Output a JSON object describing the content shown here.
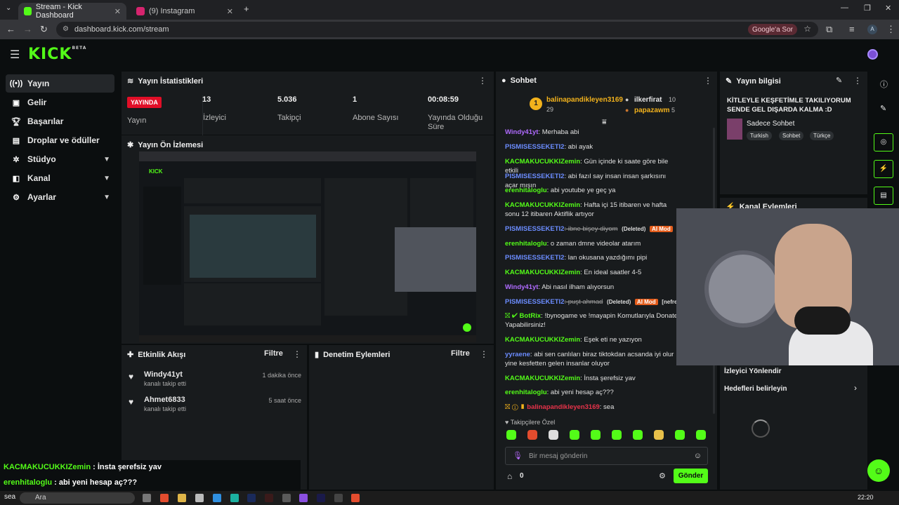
{
  "browser": {
    "tabs": [
      {
        "title": "Stream - Kick Dashboard",
        "active": true,
        "favicon_color": "#53fc18"
      },
      {
        "title": "(9) Instagram",
        "active": false,
        "favicon_color": "#d6246e"
      }
    ],
    "url": "dashboard.kick.com/stream",
    "ask_google_label": "Google'a Sor"
  },
  "brand": {
    "logo": "KICK",
    "logo_tag": "BETA",
    "accent": "#53fc18"
  },
  "sidebar": {
    "items": [
      {
        "label": "Yayın",
        "icon": "broadcast-icon",
        "active": true,
        "expandable": false
      },
      {
        "label": "Gelir",
        "icon": "revenue-icon",
        "active": false,
        "expandable": false
      },
      {
        "label": "Başarılar",
        "icon": "trophy-icon",
        "active": false,
        "expandable": false
      },
      {
        "label": "Droplar ve ödüller",
        "icon": "gift-icon",
        "active": false,
        "expandable": false
      },
      {
        "label": "Stüdyo",
        "icon": "studio-icon",
        "active": false,
        "expandable": true
      },
      {
        "label": "Kanal",
        "icon": "channel-icon",
        "active": false,
        "expandable": true
      },
      {
        "label": "Ayarlar",
        "icon": "gear-icon",
        "active": false,
        "expandable": true
      }
    ]
  },
  "stats": {
    "title": "Yayın İstatistikleri",
    "live_badge": "YAYINDA",
    "live_label": "Yayın",
    "viewers": "13",
    "viewers_label": "İzleyici",
    "followers": "5.036",
    "followers_label": "Takipçi",
    "subs": "1",
    "subs_label": "Abone Sayısı",
    "uptime": "00:08:59",
    "uptime_label": "Yayında Olduğu Süre"
  },
  "preview": {
    "title": "Yayın Ön İzlemesi"
  },
  "events": {
    "title": "Etkinlik Akışı",
    "filter": "Filtre",
    "items": [
      {
        "user": "Windy41yt",
        "action": "kanalı takip etti",
        "time": "1 dakika önce"
      },
      {
        "user": "Ahmet6833",
        "action": "kanalı takip etti",
        "time": "5 saat önce"
      }
    ]
  },
  "moderation": {
    "title": "Denetim Eylemleri",
    "filter": "Filtre"
  },
  "chat": {
    "title": "Sohbet",
    "top_gifters": [
      {
        "rank": "1",
        "name": "balinapandikleyen3169",
        "count": "29"
      },
      {
        "name": "ilkerfirat",
        "count": "10"
      },
      {
        "name": "papazawm",
        "count": "5"
      }
    ],
    "messages": [
      {
        "user": "Windy41yt",
        "color": "#b06bff",
        "text": ": Merhaba abi"
      },
      {
        "user": "PISMISESSEKETI2",
        "color": "#6b8cff",
        "text": ": abi ayak"
      },
      {
        "user": "KACMAKUCUKKIZemin",
        "color": "#53fc18",
        "text": ": Gün içinde ki saate göre bile etkili"
      },
      {
        "user": "PISMISESSEKETI2",
        "color": "#6b8cff",
        "text": ": abi fazıl say insan insan şarkısını açar mışın"
      },
      {
        "user": "erenhitaloglu",
        "color": "#53fc18",
        "text": ": abi youtube ye geç ya"
      },
      {
        "user": "KACMAKUCUKKIZemin",
        "color": "#53fc18",
        "text": ": Hafta içi 15 itibaren ve hafta sonu 12 itibaren Aktiflik artıyor"
      },
      {
        "user": "PISMISESSEKETI2",
        "color": "#6b8cff",
        "text": ": ibne bişey diyom",
        "deleted": "(Deleted)",
        "mod": "AI Mod",
        "note": "[nefret"
      },
      {
        "user": "erenhitaloglu",
        "color": "#53fc18",
        "text": ": o zaman dmne videolar atarım"
      },
      {
        "user": "PISMISESSEKETI2",
        "color": "#6b8cff",
        "text": ": lan okusana yazdığımı pipi"
      },
      {
        "user": "KACMAKUCUKKIZemin",
        "color": "#53fc18",
        "text": ": En ideal saatler 4-5"
      },
      {
        "user": "Windy41yt",
        "color": "#b06bff",
        "text": ": Abi nasıl ilham alıyorsun"
      },
      {
        "user": "PISMISESSEKETI2",
        "color": "#6b8cff",
        "text": ": puşt ahmad",
        "deleted": "(Deleted)",
        "mod": "AI Mod",
        "note": "[nefret söyle"
      },
      {
        "user": "BotRix",
        "color": "#53fc18",
        "text": ": !bynogame ve !mayapin Komutlarıyla Donate Yapabilirsiniz!"
      },
      {
        "user": "KACMAKUCUKKIZemin",
        "color": "#53fc18",
        "text": ": Eşek eti ne yazıyon"
      },
      {
        "user": "yyraene",
        "color": "#6b8cff",
        "text": ": abi sen canlıları biraz tiktokdan acsanda iyi olur yine kesfetten gelen insanlar oluyor"
      },
      {
        "user": "KACMAKUCUKKIZemin",
        "color": "#53fc18",
        "text": ": İnsta şerefsiz yav"
      },
      {
        "user": "erenhitaloglu",
        "color": "#53fc18",
        "text": ": abi yeni hesap aç???"
      },
      {
        "user": "balinapandikleyen3169",
        "color": "#e8334a",
        "text": ": sea"
      }
    ],
    "followers_only": "Takipçilere Özel",
    "input_placeholder": "Bir mesaj gönderin",
    "count": "0",
    "send_label": "Gönder"
  },
  "stream_info": {
    "title": "Yayın bilgisi",
    "stream_title": "KİTLEYLE KEŞFETİMLE TAKILIYORUM SENDE GEL DIŞARDA KALMA :D",
    "category": "Sadece Sohbet",
    "tags": [
      "Turkish",
      "Sohbet",
      "Türkçe"
    ]
  },
  "channel_actions": {
    "title": "Kanal Eylemleri",
    "item1": "İzleyici Yönlendir",
    "item2": "Hedefleri belirleyin"
  },
  "overlay_chat": [
    {
      "user": "KACMAKUCUKKIZemin",
      "text": " : İnsta şerefsiz yav"
    },
    {
      "user": "erenhitaloglu",
      "text": " : abi yeni hesap aç???"
    }
  ],
  "taskbar": {
    "search": "Ara",
    "time": "22:20",
    "sea": "sea"
  }
}
